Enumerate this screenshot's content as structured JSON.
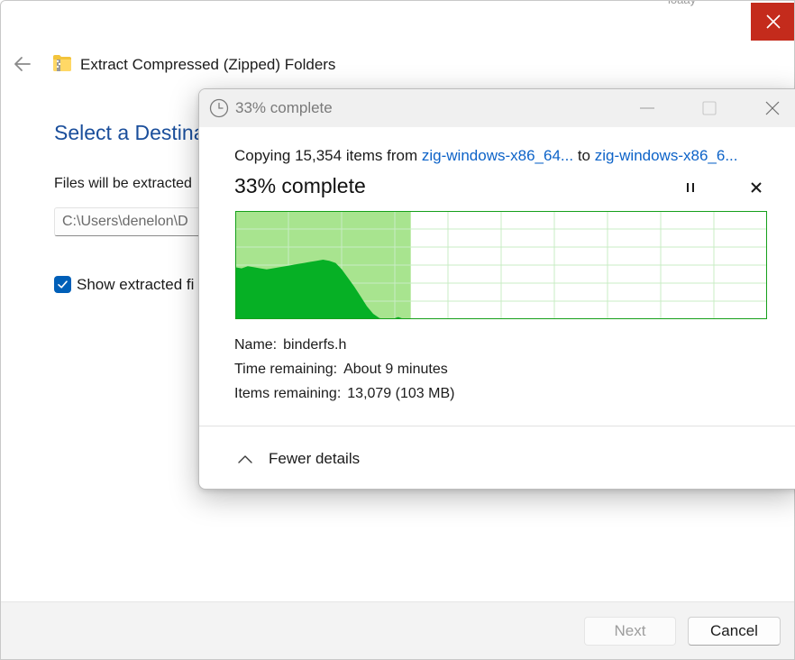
{
  "background_window": {
    "ghost_text": "loaay",
    "title": "Extract Compressed (Zipped) Folders",
    "heading": "Select a Destina",
    "extract_label": "Files will be extracted",
    "path_value": "C:\\Users\\denelon\\D",
    "checkbox_label": "Show extracted fi",
    "checkbox_checked": true,
    "next_label": "Next",
    "cancel_label": "Cancel",
    "icons": {
      "close": "close-icon",
      "back": "back-arrow-icon",
      "zip": "zip-folder-icon",
      "check": "checkmark-icon"
    },
    "colors": {
      "close_bg": "#c42b1c",
      "heading": "#1a4e9b",
      "checkbox": "#005fb8"
    }
  },
  "progress_dialog": {
    "title": "33% complete",
    "copy_prefix": "Copying 15,354 items from",
    "source_link": "zig-windows-x86_64...",
    "copy_middle": "to",
    "dest_link": "zig-windows-x86_6...",
    "percent_label": "33% complete",
    "progress_fraction": 0.33,
    "name_label": "Name:",
    "name_value": "binderfs.h",
    "time_label": "Time remaining:",
    "time_value": "About 9 minutes",
    "items_label": "Items remaining:",
    "items_value": "13,079 (103 MB)",
    "details_toggle": "Fewer details",
    "icons": {
      "title": "clock-icon",
      "minimize": "minimize-icon",
      "maximize": "maximize-icon",
      "close": "close-icon",
      "pause": "pause-icon",
      "stop": "stop-icon",
      "toggle": "chevron-up-icon"
    },
    "colors": {
      "link": "#0d63c8",
      "graph_fill": "#06b025",
      "graph_progress": "#a8e48f",
      "graph_grid": "#c9ecc4",
      "graph_border": "#16a01b"
    },
    "throughput_profile": [
      0.48,
      0.47,
      0.49,
      0.48,
      0.47,
      0.46,
      0.47,
      0.48,
      0.49,
      0.5,
      0.51,
      0.52,
      0.53,
      0.54,
      0.55,
      0.54,
      0.52,
      0.46,
      0.38,
      0.3,
      0.21,
      0.12,
      0.05,
      0.01,
      0.0,
      0.0,
      0.02,
      0.0,
      0.0
    ]
  }
}
